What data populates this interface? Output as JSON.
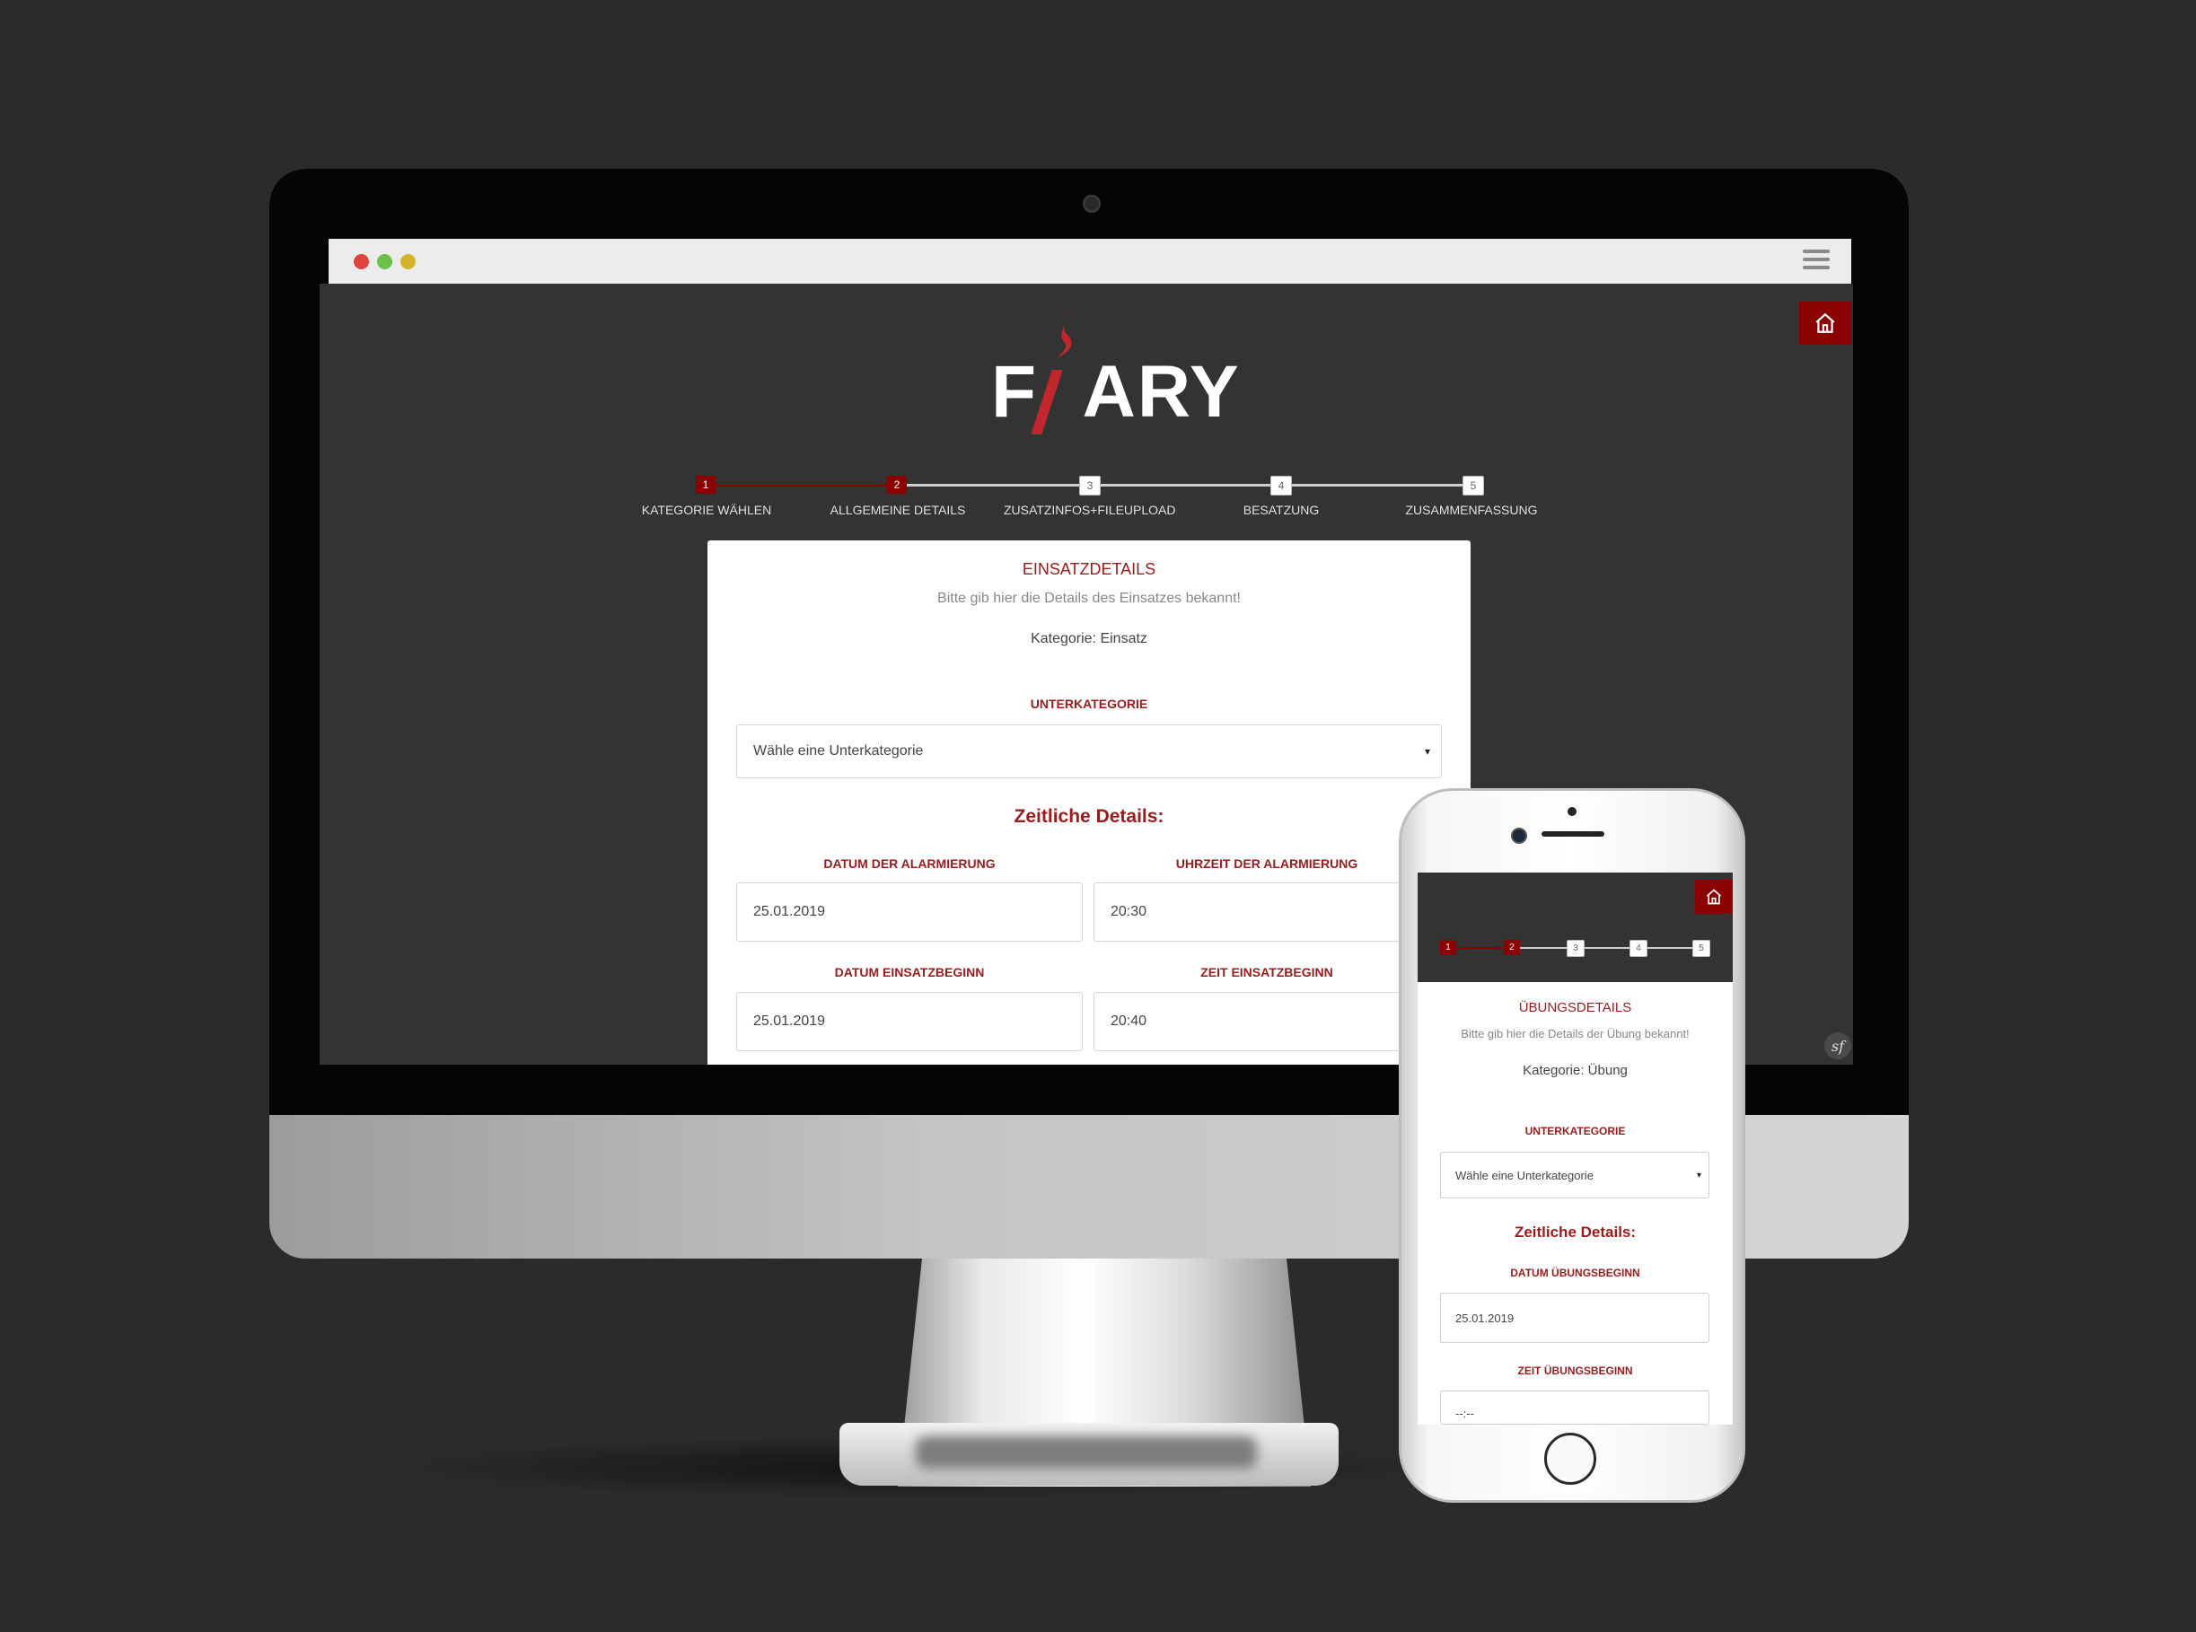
{
  "app": {
    "logo_text": "FIARY",
    "colors": {
      "accent": "#8b0000",
      "brand_red": "#c1272d",
      "screen_bg": "#333333",
      "page_bg": "#2b2b2b"
    }
  },
  "browser": {
    "window_dots": [
      "#e0443e",
      "#6cbf4a",
      "#d4b32f"
    ],
    "menu_icon": "hamburger-icon"
  },
  "nav": {
    "home_icon": "home-icon"
  },
  "stepper": {
    "steps": [
      {
        "num": "1",
        "label": "KATEGORIE WÄHLEN",
        "done": true
      },
      {
        "num": "2",
        "label": "ALLGEMEINE DETAILS",
        "done": true
      },
      {
        "num": "3",
        "label": "ZUSATZINFOS+FILEUPLOAD",
        "done": false
      },
      {
        "num": "4",
        "label": "BESATZUNG",
        "done": false
      },
      {
        "num": "5",
        "label": "ZUSAMMENFASSUNG",
        "done": false
      }
    ]
  },
  "desktop_form": {
    "title": "EINSATZDETAILS",
    "subtitle": "Bitte gib hier die Details des Einsatzes bekannt!",
    "category": "Kategorie: Einsatz",
    "subcategory_label": "UNTERKATEGORIE",
    "subcategory_value": "Wähle eine Unterkategorie",
    "section_title": "Zeitliche Details:",
    "fields": [
      {
        "label": "DATUM DER ALARMIERUNG",
        "value": "25.01.2019"
      },
      {
        "label": "UHRZEIT DER ALARMIERUNG",
        "value": "20:30"
      },
      {
        "label": "DATUM EINSATZBEGINN",
        "value": "25.01.2019"
      },
      {
        "label": "ZEIT EINSATZBEGINN",
        "value": "20:40"
      }
    ]
  },
  "mobile_form": {
    "title": "ÜBUNGSDETAILS",
    "subtitle": "Bitte gib hier die Details der Übung bekannt!",
    "category": "Kategorie: Übung",
    "subcategory_label": "UNTERKATEGORIE",
    "subcategory_value": "Wähle eine Unterkategorie",
    "section_title": "Zeitliche Details:",
    "fields": [
      {
        "label": "DATUM ÜBUNGSBEGINN",
        "value": "25.01.2019"
      },
      {
        "label": "ZEIT ÜBUNGSBEGINN",
        "value": "--:--"
      }
    ]
  },
  "footer": {
    "symfony_badge": "sf"
  },
  "select_arrow": "▾"
}
